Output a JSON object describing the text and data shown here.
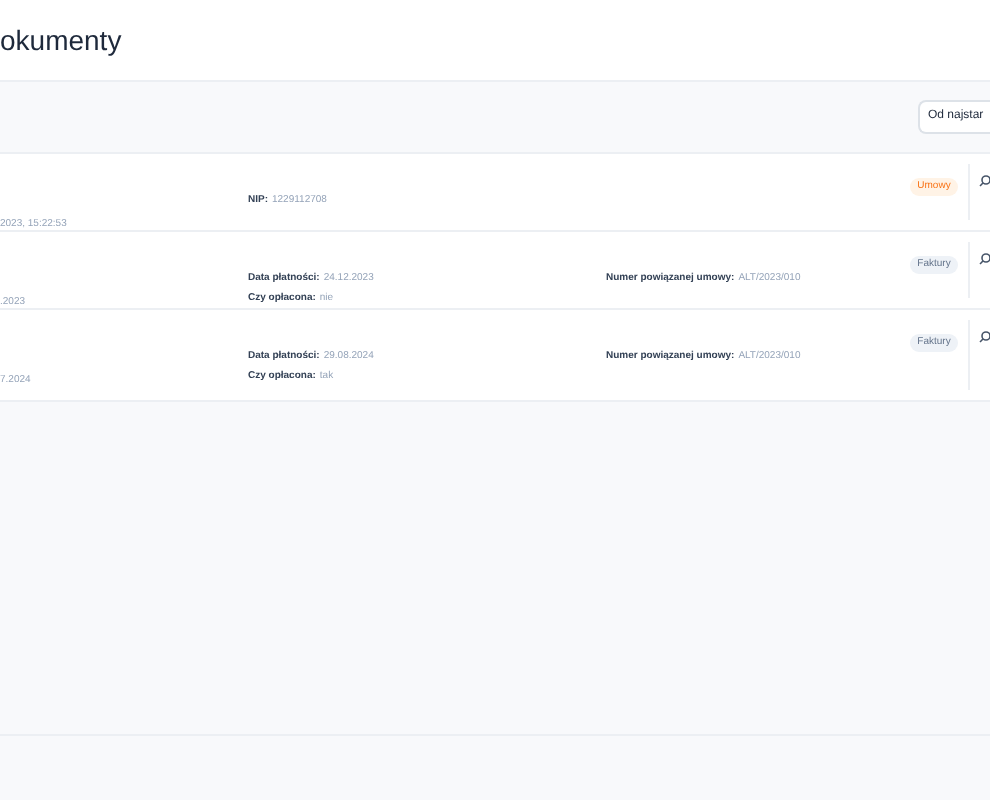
{
  "title": "okumenty",
  "sort": {
    "value": "Od najstar"
  },
  "rows": [
    {
      "date": "2023, 15:22:53",
      "fields": [
        {
          "label": "NIP:",
          "value": "1229112708"
        }
      ],
      "link": null,
      "tag": {
        "label": "Umowy",
        "color": "#f97316"
      }
    },
    {
      "date": ".2023",
      "fields": [
        {
          "label": "Data płatności:",
          "value": "24.12.2023"
        },
        {
          "label": "Czy opłacona:",
          "value": "nie"
        }
      ],
      "link": {
        "label": "Numer powiązanej umowy:",
        "value": "ALT/2023/010"
      },
      "tag": {
        "label": "Faktury",
        "color": "#64748b"
      }
    },
    {
      "date": "7.2024",
      "fields": [
        {
          "label": "Data płatności:",
          "value": "29.08.2024"
        },
        {
          "label": "Czy opłacona:",
          "value": "tak"
        }
      ],
      "link": {
        "label": "Numer powiązanej umowy:",
        "value": "ALT/2023/010"
      },
      "tag": {
        "label": "Faktury",
        "color": "#64748b"
      }
    }
  ]
}
